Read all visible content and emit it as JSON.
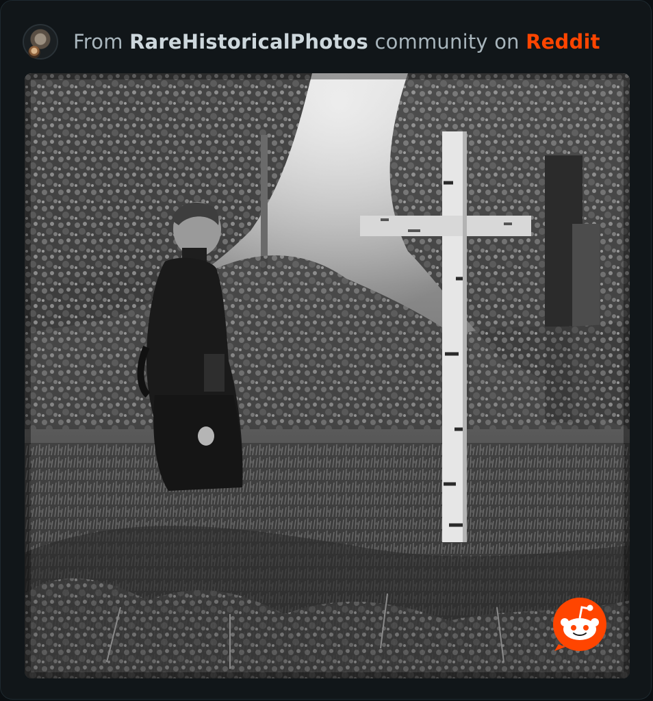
{
  "header": {
    "prefix": "From ",
    "community": "RareHistoricalPhotos",
    "middle": " community on ",
    "platform": "Reddit"
  },
  "colors": {
    "background": "#111619",
    "text": "#a9b6bd",
    "community": "#cdd7dc",
    "brand": "#ff4500"
  },
  "icons": {
    "avatar": "community-avatar",
    "badge": "reddit-snoo-icon"
  }
}
